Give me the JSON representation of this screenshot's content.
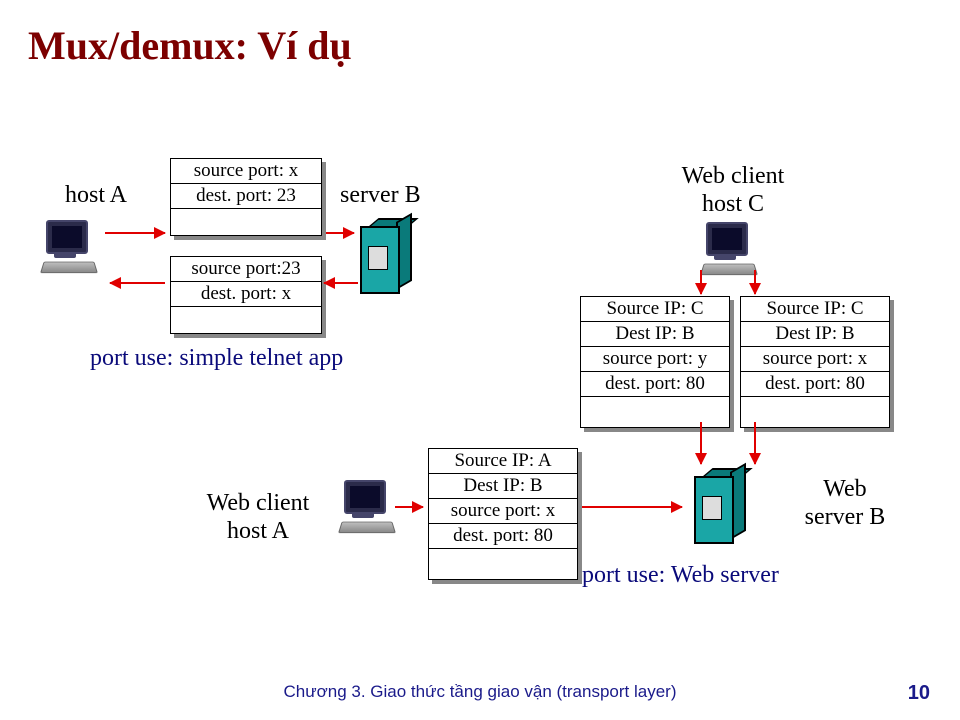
{
  "title": "Mux/demux: Ví dụ",
  "labels": {
    "hostA": "host A",
    "serverB": "server B",
    "webClientC_line1": "Web client",
    "webClientC_line2": "host C",
    "webClientA_line1": "Web client",
    "webClientA_line2": "host A",
    "webServerB_line1": "Web",
    "webServerB_line2": "server B"
  },
  "captions": {
    "telnet": "port use: simple telnet app",
    "web": "port use: Web server"
  },
  "packets": {
    "p1": {
      "r0": "source port: x",
      "r1": "dest. port: 23"
    },
    "p2": {
      "r0": "source port:23",
      "r1": "dest. port: x"
    },
    "p3": {
      "r0": "Source IP: C",
      "r1": "Dest IP: B",
      "r2": "source port: y",
      "r3": "dest. port: 80"
    },
    "p4": {
      "r0": "Source IP: C",
      "r1": "Dest IP: B",
      "r2": "source port: x",
      "r3": "dest. port: 80"
    },
    "p5": {
      "r0": "Source IP: A",
      "r1": "Dest IP: B",
      "r2": "source port: x",
      "r3": "dest. port: 80"
    }
  },
  "footer": "Chương 3. Giao thức tầng giao vận (transport layer)",
  "page": "10"
}
